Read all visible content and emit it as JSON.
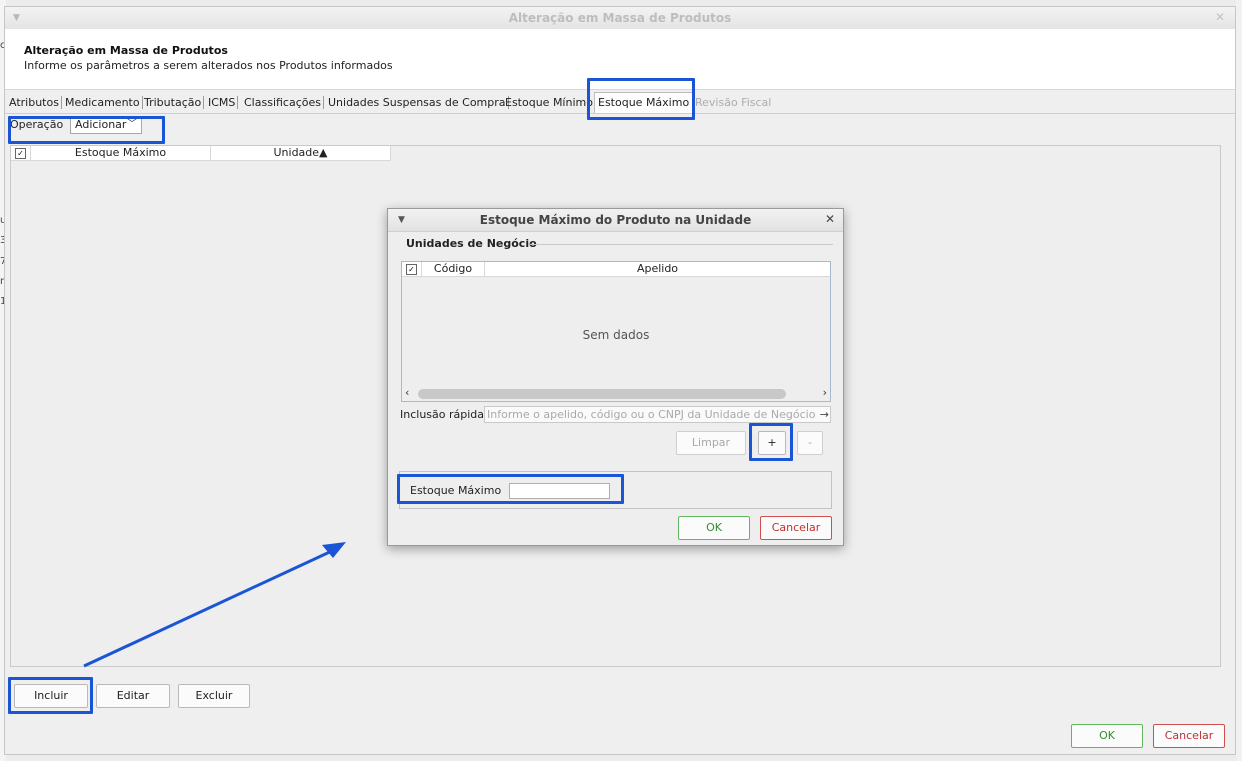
{
  "window": {
    "title": "Alteração em Massa de Produtos",
    "header_title": "Alteração em Massa de Produtos",
    "header_subtitle": "Informe os parâmetros a serem alterados nos Produtos informados"
  },
  "tabs": [
    {
      "label": "Atributos",
      "state": "normal"
    },
    {
      "label": "Medicamento",
      "state": "normal"
    },
    {
      "label": "Tributação",
      "state": "normal"
    },
    {
      "label": "ICMS",
      "state": "normal"
    },
    {
      "label": "Classificações",
      "state": "normal"
    },
    {
      "label": "Unidades Suspensas de Compra",
      "state": "normal"
    },
    {
      "label": "Estoque Mínimo",
      "state": "normal"
    },
    {
      "label": "Estoque Máximo",
      "state": "active"
    },
    {
      "label": "Revisão Fiscal",
      "state": "disabled"
    }
  ],
  "operation": {
    "label": "Operação",
    "selected": "Adicionar"
  },
  "main_grid": {
    "columns": [
      "Estoque Máximo",
      "Unidade▲"
    ]
  },
  "main_buttons": {
    "incluir": "Incluir",
    "editar": "Editar",
    "excluir": "Excluir",
    "ok": "OK",
    "cancelar": "Cancelar"
  },
  "dialog": {
    "title": "Estoque Máximo do Produto na Unidade",
    "section": "Unidades de Negócio",
    "columns": [
      "Código",
      "Apelido"
    ],
    "empty_text": "Sem dados",
    "quick_label": "Inclusão rápida",
    "quick_placeholder": "Informe o apelido, código ou o CNPJ da Unidade de Negócio",
    "limpar": "Limpar",
    "add": "+",
    "remove": "-",
    "estoque_label": "Estoque Máximo",
    "estoque_value": "",
    "ok": "OK",
    "cancelar": "Cancelar"
  },
  "colors": {
    "highlight": "#1a55d6",
    "ok_border": "#5fb75f",
    "cancel_border": "#d05050"
  }
}
